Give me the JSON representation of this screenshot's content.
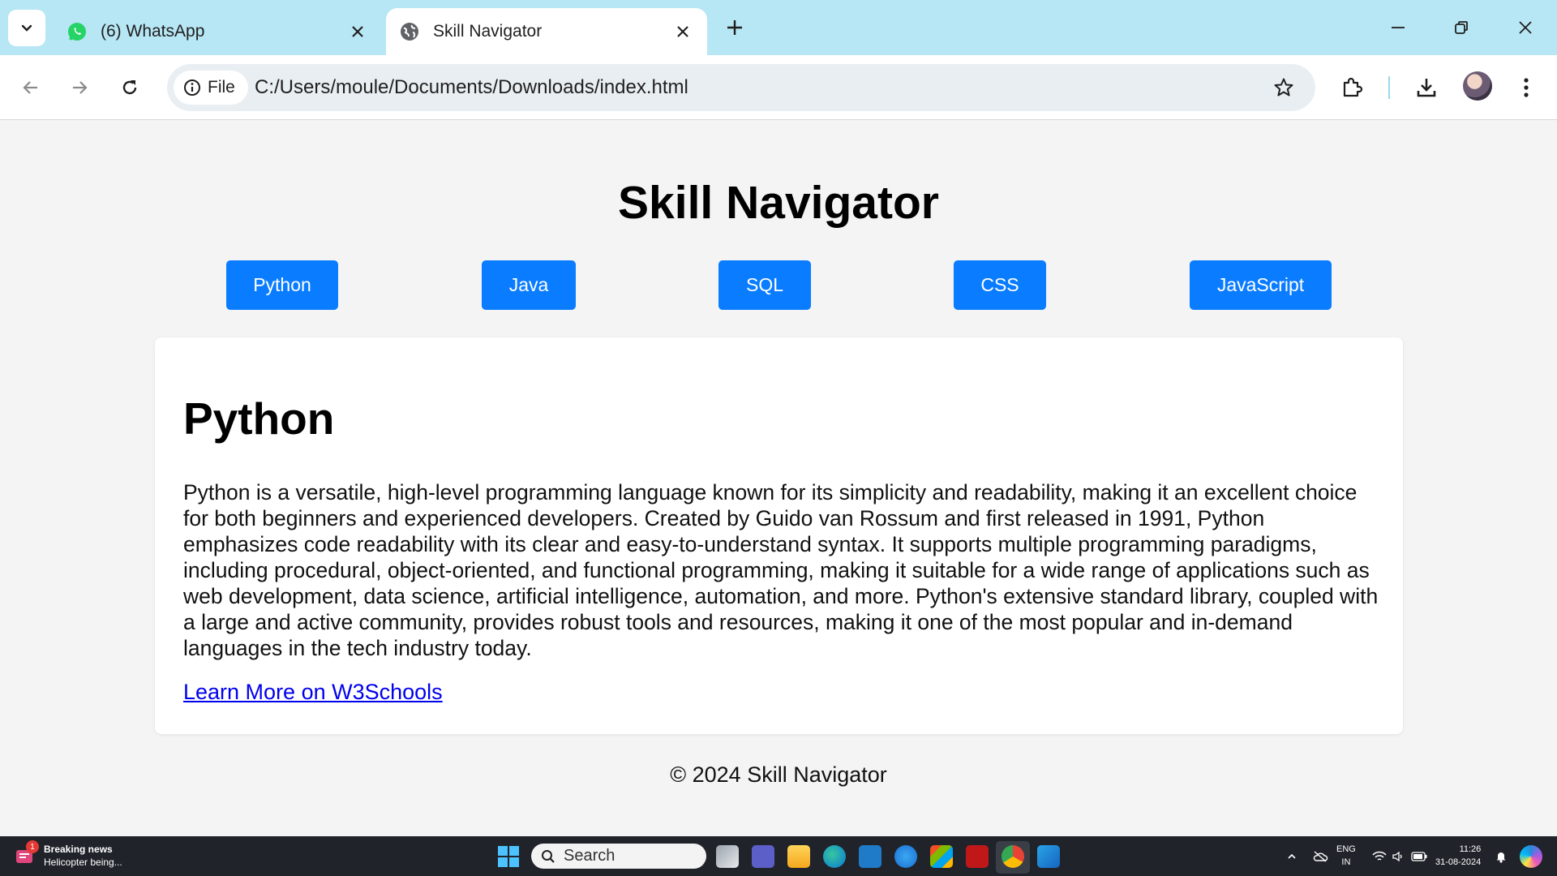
{
  "browser": {
    "tabs": [
      {
        "title": "(6) WhatsApp",
        "icon": "whatsapp-icon",
        "active": false
      },
      {
        "title": "Skill Navigator",
        "icon": "globe-icon",
        "active": true
      }
    ],
    "site_chip_label": "File",
    "url": "C:/Users/moule/Documents/Downloads/index.html"
  },
  "page": {
    "title": "Skill Navigator",
    "skills": [
      "Python",
      "Java",
      "SQL",
      "CSS",
      "JavaScript"
    ],
    "button_color": "#0a7cff",
    "card": {
      "heading": "Python",
      "description": "Python is a versatile, high-level programming language known for its simplicity and readability, making it an excellent choice for both beginners and experienced developers. Created by Guido van Rossum and first released in 1991, Python emphasizes code readability with its clear and easy-to-understand syntax. It supports multiple programming paradigms, including procedural, object-oriented, and functional programming, making it suitable for a wide range of applications such as web development, data science, artificial intelligence, automation, and more. Python's extensive standard library, coupled with a large and active community, provides robust tools and resources, making it one of the most popular and in-demand languages in the tech industry today.",
      "link_text": "Learn More on W3Schools",
      "link_color": "#0000ee"
    },
    "footer": "© 2024 Skill Navigator"
  },
  "taskbar": {
    "news_badge": "1",
    "news_title": "Breaking news",
    "news_subtitle": "Helicopter being...",
    "search_label": "Search",
    "lang_primary": "ENG",
    "lang_secondary": "IN",
    "time": "11:26",
    "date": "31-08-2024"
  }
}
